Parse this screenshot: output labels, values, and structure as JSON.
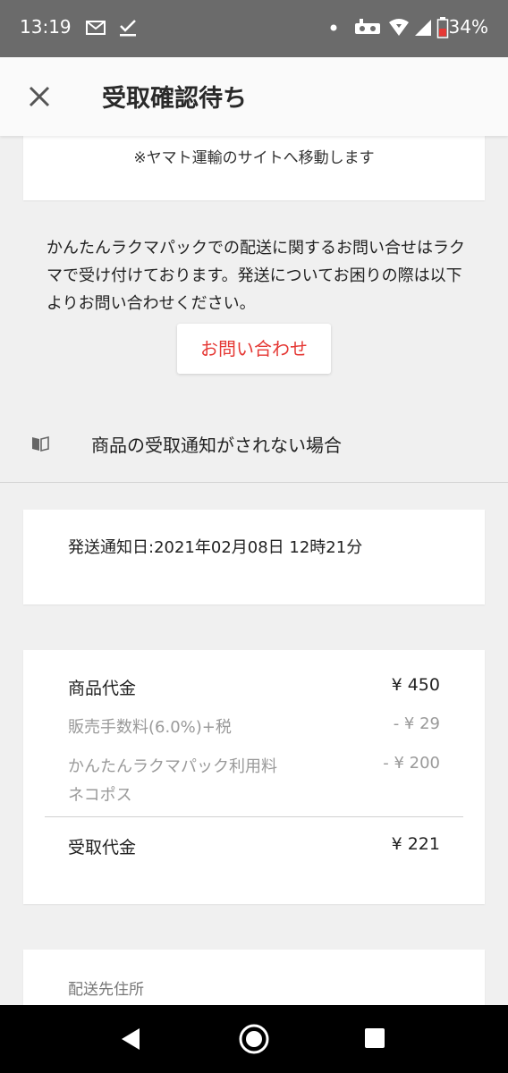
{
  "status_bar": {
    "time": "13:19",
    "battery": "34%"
  },
  "header": {
    "title": "受取確認待ち"
  },
  "yamato": {
    "note": "※ヤマト運輸のサイトへ移動します"
  },
  "contact": {
    "text": "かんたんラクマパックでの配送に関するお問い合せはラクマで受け付けております。発送についてお困りの際は以下よりお問い合わせください。",
    "button": "お問い合わせ"
  },
  "not_notified": {
    "label": "商品の受取通知がされない場合"
  },
  "shipment": {
    "date_text": "発送通知日:2021年02月08日 12時21分"
  },
  "summary": {
    "item_price_label": "商品代金",
    "item_price": "¥ 450",
    "fee_label": "販売手数料(6.0%)+税",
    "fee": "- ¥ 29",
    "shipping_label": "かんたんラクマパック利用料",
    "shipping_sub": "ネコポス",
    "shipping": "- ¥ 200",
    "total_label": "受取代金",
    "total": "¥ 221"
  },
  "address": {
    "label": "配送先住所"
  },
  "colors": {
    "accent": "#e53935",
    "status_bar": "#6b6b6b",
    "background": "#f0f0f0"
  }
}
